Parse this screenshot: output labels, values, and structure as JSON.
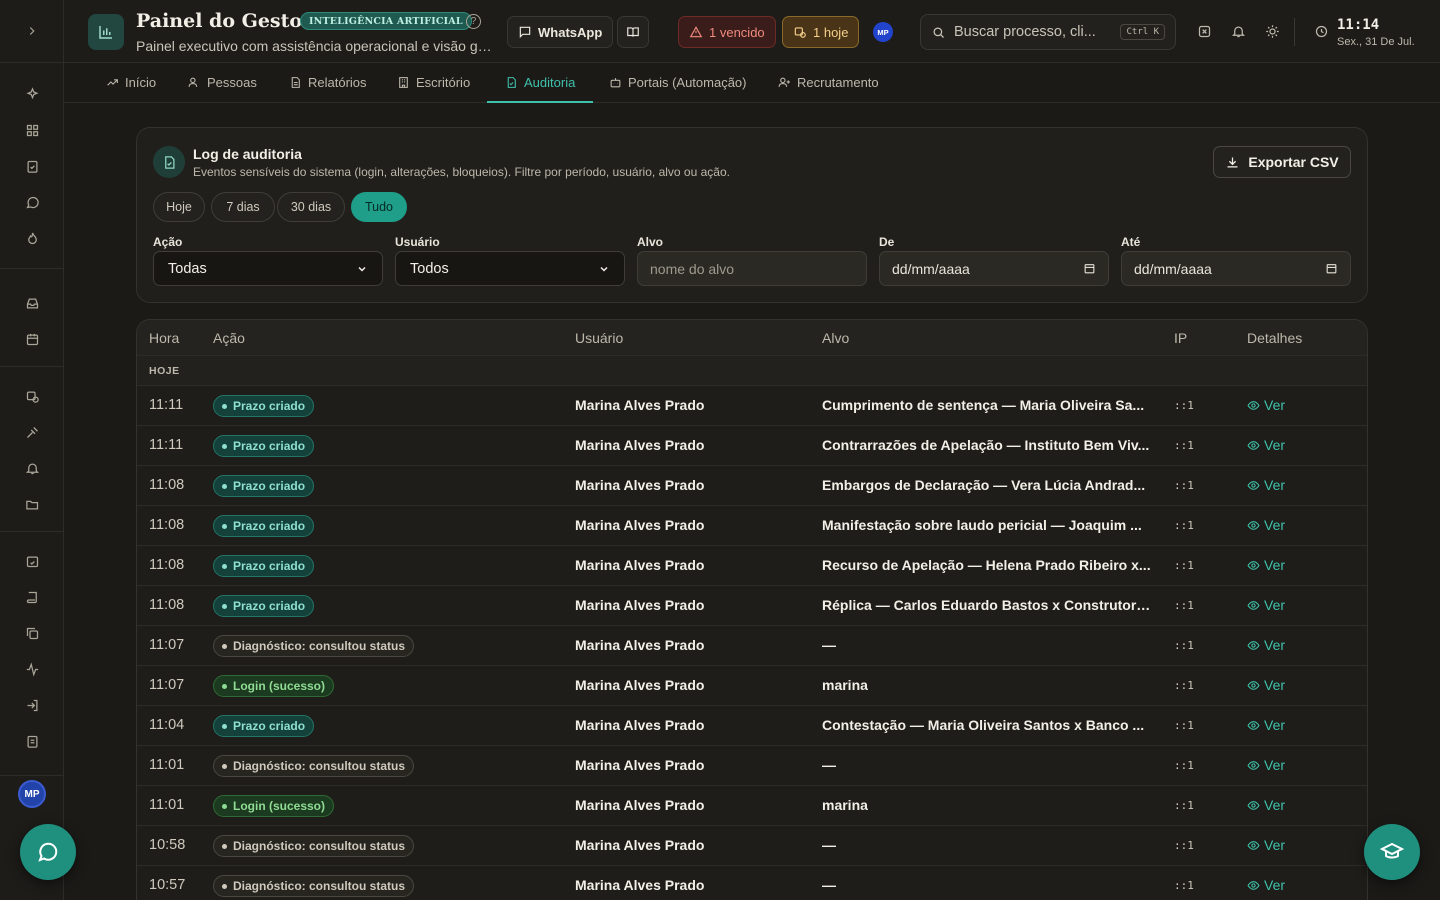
{
  "header": {
    "title": "Painel do Gestor",
    "ai_badge": "INTELIGÊNCIA ARTIFICIAL",
    "help": "?",
    "subtitle": "Painel executivo com assistência operacional e visão geral do escritório",
    "whatsapp_label": "WhatsApp",
    "overdue_label": "1 vencido",
    "today_label": "1 hoje",
    "user_initials": "MP",
    "search_placeholder": "Buscar processo, cli...",
    "search_shortcut": "Ctrl K",
    "clock_time": "11:14",
    "clock_date": "Sex., 31 De Jul."
  },
  "sidebar": {
    "user_initials": "MP"
  },
  "tabs": [
    {
      "label": "Início",
      "icon": "trending-up-icon"
    },
    {
      "label": "Pessoas",
      "icon": "users-icon"
    },
    {
      "label": "Relatórios",
      "icon": "file-text-icon"
    },
    {
      "label": "Escritório",
      "icon": "building-icon"
    },
    {
      "label": "Auditoria",
      "icon": "audit-icon",
      "active": true
    },
    {
      "label": "Portais (Automação)",
      "icon": "bot-icon"
    },
    {
      "label": "Recrutamento",
      "icon": "user-plus-icon"
    }
  ],
  "audit": {
    "title": "Log de auditoria",
    "description": "Eventos sensíveis do sistema (login, alterações, bloqueios). Filtre por período, usuário, alvo ou ação.",
    "export_label": "Exportar CSV",
    "periods": [
      "Hoje",
      "7 dias",
      "30 dias",
      "Tudo"
    ],
    "active_period": "Tudo",
    "filters": {
      "action_label": "Ação",
      "action_value": "Todas",
      "user_label": "Usuário",
      "user_value": "Todos",
      "target_label": "Alvo",
      "target_placeholder": "nome do alvo",
      "from_label": "De",
      "from_placeholder": "dd/mm/aaaa",
      "to_label": "Até",
      "to_placeholder": "dd/mm/aaaa"
    }
  },
  "table": {
    "columns": [
      "Hora",
      "Ação",
      "Usuário",
      "Alvo",
      "IP",
      "Detalhes"
    ],
    "group_label": "HOJE",
    "view_label": "Ver",
    "rows": [
      {
        "time": "11:11",
        "action": "Prazo criado",
        "kind": "teal",
        "user": "Marina Alves Prado",
        "target": "Cumprimento de sentença — Maria Oliveira Sa...",
        "ip": "::1"
      },
      {
        "time": "11:11",
        "action": "Prazo criado",
        "kind": "teal",
        "user": "Marina Alves Prado",
        "target": "Contrarrazões de Apelação — Instituto Bem Viv...",
        "ip": "::1"
      },
      {
        "time": "11:08",
        "action": "Prazo criado",
        "kind": "teal",
        "user": "Marina Alves Prado",
        "target": "Embargos de Declaração — Vera Lúcia Andrad...",
        "ip": "::1"
      },
      {
        "time": "11:08",
        "action": "Prazo criado",
        "kind": "teal",
        "user": "Marina Alves Prado",
        "target": "Manifestação sobre laudo pericial — Joaquim ...",
        "ip": "::1"
      },
      {
        "time": "11:08",
        "action": "Prazo criado",
        "kind": "teal",
        "user": "Marina Alves Prado",
        "target": "Recurso de Apelação — Helena Prado Ribeiro x...",
        "ip": "::1"
      },
      {
        "time": "11:08",
        "action": "Prazo criado",
        "kind": "teal",
        "user": "Marina Alves Prado",
        "target": "Réplica — Carlos Eduardo Bastos x Construtora...",
        "ip": "::1"
      },
      {
        "time": "11:07",
        "action": "Diagnóstico: consultou status",
        "kind": "grey",
        "user": "Marina Alves Prado",
        "target": "—",
        "ip": "::1"
      },
      {
        "time": "11:07",
        "action": "Login (sucesso)",
        "kind": "green",
        "user": "Marina Alves Prado",
        "target": "marina",
        "ip": "::1"
      },
      {
        "time": "11:04",
        "action": "Prazo criado",
        "kind": "teal",
        "user": "Marina Alves Prado",
        "target": "Contestação — Maria Oliveira Santos x Banco ...",
        "ip": "::1"
      },
      {
        "time": "11:01",
        "action": "Diagnóstico: consultou status",
        "kind": "grey",
        "user": "Marina Alves Prado",
        "target": "—",
        "ip": "::1"
      },
      {
        "time": "11:01",
        "action": "Login (sucesso)",
        "kind": "green",
        "user": "Marina Alves Prado",
        "target": "marina",
        "ip": "::1"
      },
      {
        "time": "10:58",
        "action": "Diagnóstico: consultou status",
        "kind": "grey",
        "user": "Marina Alves Prado",
        "target": "—",
        "ip": "::1"
      },
      {
        "time": "10:57",
        "action": "Diagnóstico: consultou status",
        "kind": "grey",
        "user": "Marina Alves Prado",
        "target": "—",
        "ip": "::1"
      }
    ]
  },
  "colors": {
    "accent": "#3fc0ab",
    "background": "#1b1a17",
    "overdue": "#f08a7e",
    "today": "#f4cf8a"
  }
}
